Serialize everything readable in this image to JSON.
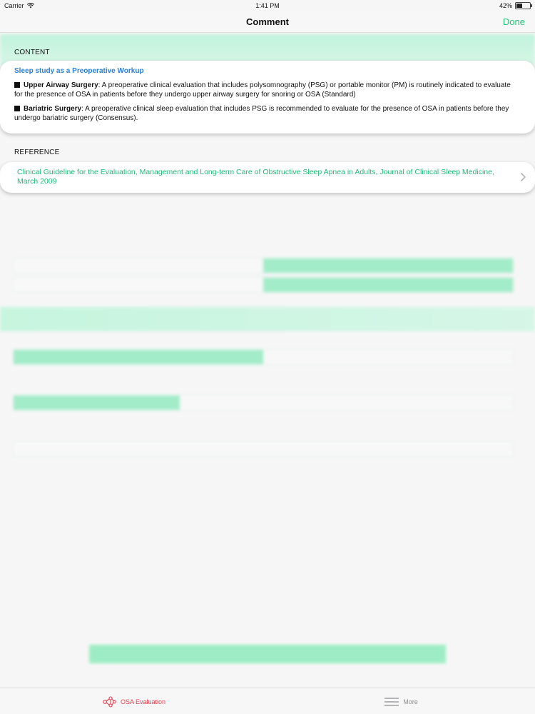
{
  "status_bar": {
    "carrier": "Carrier",
    "time": "1:41 PM",
    "battery_percent": "42%",
    "battery_level": 0.42,
    "wifi_icon": "wifi-icon",
    "battery_icon": "battery-icon"
  },
  "nav": {
    "title": "Comment",
    "done_label": "Done"
  },
  "content_section": {
    "header": "CONTENT",
    "card_title": "Sleep study as a Preoperative Workup",
    "items": [
      {
        "term": "Upper Airway Surgery",
        "text": ": A preoperative clinical evaluation that includes polysomnography (PSG) or portable monitor (PM) is routinely indicated to evaluate for the presence of OSA in patients before they undergo upper airway surgery for snoring or OSA (Standard)"
      },
      {
        "term": "Bariatric Surgery",
        "text": ": A preoperative clinical sleep evaluation that includes PSG is recommended to evaluate for the presence of OSA in patients before they undergo bariatric surgery (Consensus)."
      }
    ]
  },
  "reference_section": {
    "header": "REFERENCE",
    "text": "Clinical Guideline for the Evaluation, Management and Long-term Care of Obstructive Sleep Apnea in Adults, Journal of Clinical Sleep Medicine, March 2009",
    "icon": "chevron-right-icon"
  },
  "tab_bar": {
    "tabs": [
      {
        "label": "OSA Evaluation",
        "icon": "network-icon",
        "active": true,
        "color": "#e4404f"
      },
      {
        "label": "More",
        "icon": "menu-icon",
        "active": false,
        "color": "#8e8e93"
      }
    ]
  },
  "colors": {
    "accent_green": "#27c27a",
    "link_green": "#1fb97a",
    "title_blue": "#2b7fd2",
    "tab_active_red": "#e4404f"
  }
}
